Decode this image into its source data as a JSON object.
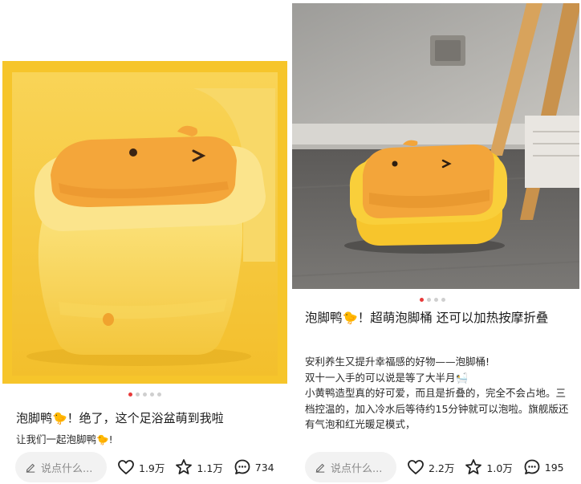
{
  "cards": [
    {
      "image_alt": "",
      "carousel_total": 5,
      "carousel_active": 0,
      "title": "泡脚鸭🐤！绝了，这个足浴盆萌到我啦",
      "body_lines": [
        "让我们一起泡脚鸭🐤!"
      ],
      "comment_placeholder": "说点什么...",
      "likes": "1.9万",
      "favorites": "1.1万",
      "comments": "734"
    },
    {
      "image_alt": "",
      "carousel_total": 4,
      "carousel_active": 0,
      "title": "泡脚鸭🐤！超萌泡脚桶 还可以加热按摩折叠",
      "body_lines": [
        "安利养生又提升幸福感的好物——泡脚桶!",
        "双十一入手的可以说是等了大半月🛀",
        "小黄鸭造型真的好可爱，而且是折叠的，完全不会占地。三档控温的，加入冷水后等待约15分钟就可以泡啦。旗舰版还有气泡和红光暖足模式，"
      ],
      "comment_placeholder": "说点什么...",
      "likes": "2.2万",
      "favorites": "1.0万",
      "comments": "195"
    }
  ],
  "colors": {
    "active_dot": "#e83a3a",
    "inactive_dot": "#cfcfcf",
    "pill_bg": "#f2f2f2",
    "duck_yellow": "#f7c52c",
    "duck_orange": "#f3a53a"
  },
  "icons": [
    "pencil-icon",
    "heart-icon",
    "star-icon",
    "comment-bubble-icon"
  ]
}
